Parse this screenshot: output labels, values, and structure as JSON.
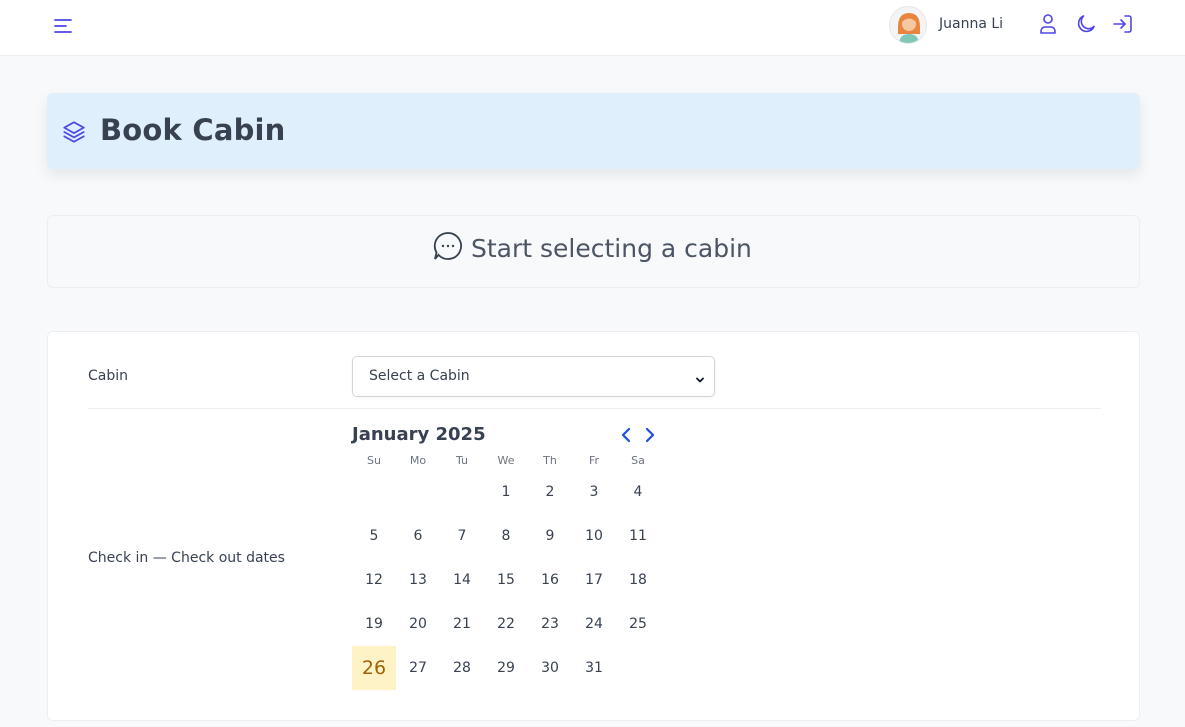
{
  "header": {
    "user_name": "Juanna Li"
  },
  "banner": {
    "title": "Book Cabin"
  },
  "start": {
    "text": "Start selecting a cabin"
  },
  "form": {
    "cabin_label": "Cabin",
    "cabin_select_value": "Select a Cabin",
    "dates_label": "Check in — Check out dates"
  },
  "calendar": {
    "month_label": "January 2025",
    "weekdays": [
      "Su",
      "Mo",
      "Tu",
      "We",
      "Th",
      "Fr",
      "Sa"
    ],
    "first_weekday_index": 3,
    "days": [
      "1",
      "2",
      "3",
      "4",
      "5",
      "6",
      "7",
      "8",
      "9",
      "10",
      "11",
      "12",
      "13",
      "14",
      "15",
      "16",
      "17",
      "18",
      "19",
      "20",
      "21",
      "22",
      "23",
      "24",
      "25",
      "26",
      "27",
      "28",
      "29",
      "30",
      "31"
    ],
    "today": "26"
  },
  "colors": {
    "accent": "#4f46e5",
    "banner_bg": "#e0effc",
    "today_bg": "#fef3c7",
    "today_text": "#a16207"
  }
}
